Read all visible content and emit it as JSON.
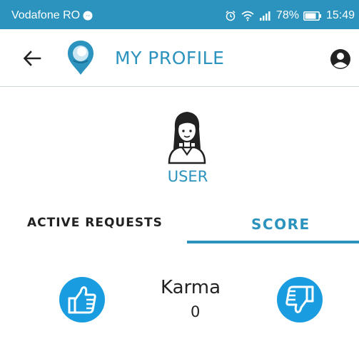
{
  "status_bar": {
    "carrier": "Vodafone RO",
    "battery": "78%",
    "time": "15:49",
    "color": "#2b93be"
  },
  "app_bar": {
    "title": "MY PROFILE",
    "back_icon": "arrow-left-icon",
    "account_icon": "account-circle-icon",
    "logo_icon": "location-pin-logo"
  },
  "profile": {
    "avatar_icon": "female-user-avatar",
    "username": "USER"
  },
  "tabs": [
    {
      "label": "ACTIVE REQUESTS",
      "active": false
    },
    {
      "label": "SCORE",
      "active": true
    }
  ],
  "score": {
    "label": "Karma",
    "value": "0",
    "upvote_icon": "thumbs-up-icon",
    "downvote_icon": "thumbs-down-icon"
  },
  "colors": {
    "accent": "#2b93be",
    "thumb_blue": "#1a9de0",
    "text": "#222222"
  }
}
